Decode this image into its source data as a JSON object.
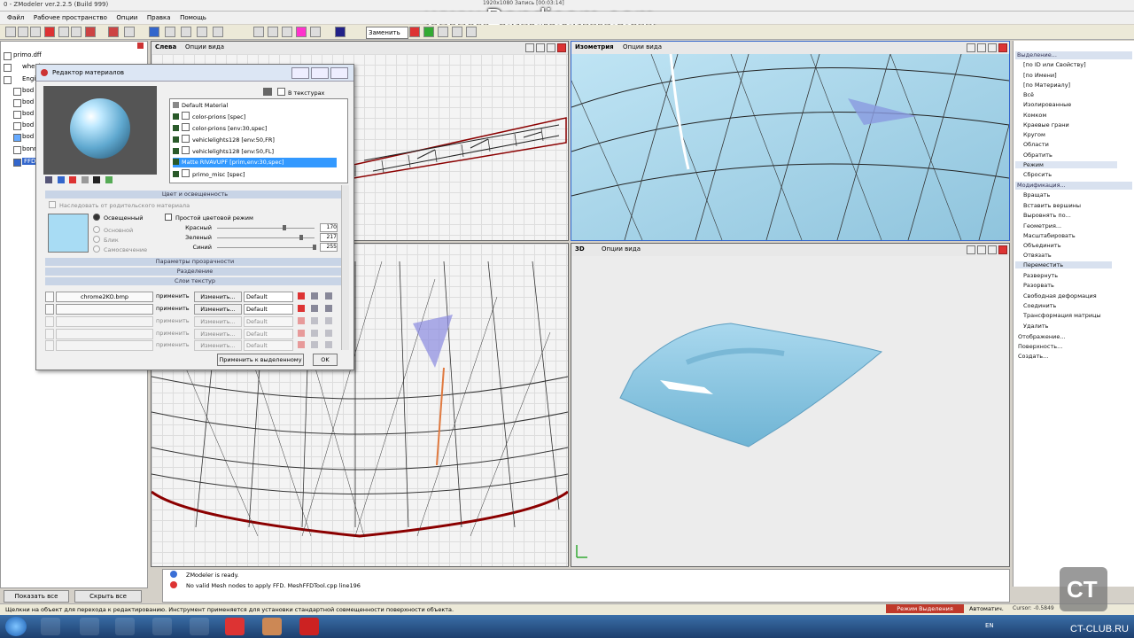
{
  "window": {
    "title": "0 - ZModeler ver.2.2.5 (Build 999)"
  },
  "recording": {
    "watermark": "www.Bandicam.com",
    "info": "1920x1080   Запись [00:03:14]"
  },
  "menu": [
    "Файл",
    "Рабочее пространство",
    "Опции",
    "Правка",
    "Помощь"
  ],
  "toolbar": {
    "selection_mode": "Заменить"
  },
  "tree": {
    "items": [
      "primo.dff",
      "wheel",
      "Engine",
      "bod",
      "bod",
      "bod",
      "bod",
      "bod",
      "bonnet",
      "FFD"
    ],
    "show_all": "Показать все",
    "hide_all": "Скрыть все"
  },
  "viewports": {
    "left": {
      "name": "Слева",
      "options": "Опции вида"
    },
    "iso": {
      "name": "Изометрия",
      "options": "Опции вида"
    },
    "top_left": {
      "name": "",
      "options": ""
    },
    "3d": {
      "name": "3D",
      "options": "Опции вида"
    }
  },
  "material_editor": {
    "title": "Редактор материалов",
    "in_textures": "В текстурах",
    "materials": [
      {
        "label": "Default Material",
        "selected": false
      },
      {
        "label": "color-prions [spec]",
        "selected": false
      },
      {
        "label": "color-prions [env:30,spec]",
        "selected": false
      },
      {
        "label": "vehiclelights128 [env:50,FR]",
        "selected": false
      },
      {
        "label": "vehiclelights128 [env:50,FL]",
        "selected": false
      },
      {
        "label": "Matte RIVAVUPF [prim,env:30,spec]",
        "selected": true
      },
      {
        "label": "primo_misc [spec]",
        "selected": false
      }
    ],
    "sec_color": "Цвет и освещенность",
    "inherit_parent": "Наследовать от родительского материала",
    "radio": [
      "Освещенный",
      "Основной",
      "Блик",
      "Самосвечение"
    ],
    "simple_mode": "Простой цветовой режим",
    "sliders": [
      {
        "label": "Красный",
        "value": "170"
      },
      {
        "label": "Зеленый",
        "value": "217"
      },
      {
        "label": "Синий",
        "value": "255"
      }
    ],
    "sec_transparency": "Параметры прозрачности",
    "sec_split": "Разделение",
    "sec_layers": "Слои текстур",
    "layers": [
      {
        "texture": "chrome2KO.bmp",
        "apply": "применить",
        "change": "Изменить...",
        "mode": "Default"
      },
      {
        "texture": "",
        "apply": "применить",
        "change": "Изменить...",
        "mode": "Default"
      },
      {
        "texture": "",
        "apply": "применить",
        "change": "Изменить...",
        "mode": "Default"
      },
      {
        "texture": "",
        "apply": "применить",
        "change": "Изменить...",
        "mode": "Default"
      },
      {
        "texture": "",
        "apply": "применить",
        "change": "Изменить...",
        "mode": "Default"
      }
    ],
    "apply_wire": "Применить к выделенному",
    "ok": "OK"
  },
  "right_panel": {
    "sec_selection": "Выделение...",
    "selection_items": [
      "[по ID или Свойству]",
      "[по Имени]",
      "[по Материалу]",
      "Всё",
      "Изолированные",
      "Комком",
      "Краевые грани",
      "Кругом",
      "Области",
      "Обратить"
    ],
    "highlight": "Режим",
    "reset": "Сбросить",
    "sec_modify": "Модификация...",
    "modify_items": [
      "Вращать",
      "Вставить вершины",
      "Выровнять по...",
      "Геометрия...",
      "Масштабировать",
      "Объединить",
      "Отвязать"
    ],
    "move": "Переместить",
    "more_items": [
      "Развернуть",
      "Разорвать",
      "Свободная деформация",
      "Соединить",
      "Трансформация матрицы",
      "Удалить"
    ],
    "tail_items": [
      "Отображение...",
      "Поверхность...",
      "Создать..."
    ]
  },
  "log": {
    "lines": [
      "ZModeler is ready.",
      "No valid Mesh nodes to apply FFD. MeshFFDTool.cpp line196"
    ]
  },
  "status": {
    "hint": "Щелкни на объект для перехода к редактированию. Инструмент применяется для установки стандартной совмещенности поверхности объекта.",
    "mode": "Режим Выделения",
    "auto": "Автоматич.",
    "cursor": "Cursor: -0.5849"
  },
  "taskbar": {
    "lang": "EN",
    "site": "CT-CLUB.RU"
  },
  "colors": {
    "accent": "#3399ff",
    "mode_badge": "#c0392b",
    "swatch": "#a8dcf4"
  }
}
